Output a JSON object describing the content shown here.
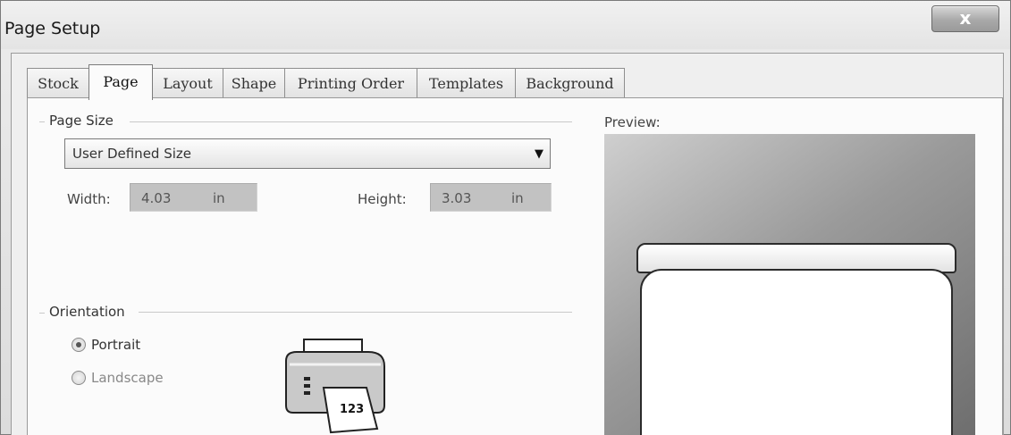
{
  "window": {
    "title": "Page Setup",
    "close_label": "x"
  },
  "tabs": [
    {
      "label": "Stock"
    },
    {
      "label": "Page"
    },
    {
      "label": "Layout"
    },
    {
      "label": "Shape"
    },
    {
      "label": "Printing Order"
    },
    {
      "label": "Templates"
    },
    {
      "label": "Background"
    }
  ],
  "active_tab": "Page",
  "page_size": {
    "group_label": "Page Size",
    "selected": "User Defined Size",
    "width_label": "Width:",
    "width_value": "4.03",
    "width_unit": "in",
    "height_label": "Height:",
    "height_value": "3.03",
    "height_unit": "in"
  },
  "orientation": {
    "group_label": "Orientation",
    "options": [
      {
        "label": "Portrait",
        "checked": true
      },
      {
        "label": "Landscape",
        "checked": false
      }
    ]
  },
  "preview": {
    "label": "Preview:"
  },
  "printer_icon": {
    "paper_text": "123"
  },
  "colors": {
    "preview_bg_light": "#cfcfcf",
    "preview_bg_dark": "#6e6e6e",
    "field_bg": "#c2c2c2"
  }
}
